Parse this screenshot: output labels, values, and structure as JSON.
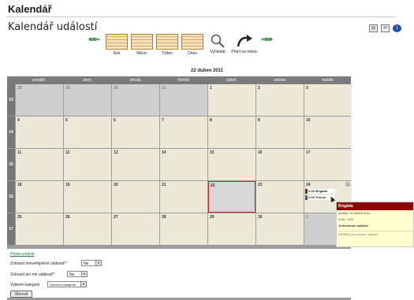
{
  "page": {
    "title": "Kalendář",
    "calendar_title": "Kalendář událostí"
  },
  "toolbar": {
    "nav_prev": "⇚⇐",
    "nav_next": "⇒⇛",
    "views": [
      {
        "label": "Rok",
        "icon": "year-grid-icon"
      },
      {
        "label": "Měsíc",
        "icon": "month-grid-icon"
      },
      {
        "label": "Týden",
        "icon": "week-grid-icon"
      },
      {
        "label": "Dnes",
        "icon": "today-icon"
      },
      {
        "label": "Vyhledat",
        "icon": "magnifier-icon"
      },
      {
        "label": "Přejít na měsíc",
        "icon": "jump-arrow-icon"
      }
    ]
  },
  "date_heading": "22 duben 2011",
  "weekdays": [
    "pondělí",
    "úterý",
    "středa",
    "čtvrtek",
    "pátek",
    "sobota",
    "neděle"
  ],
  "weeks": [
    {
      "num": "13",
      "days": [
        "28",
        "29",
        "30",
        "31",
        "1",
        "2",
        "3"
      ],
      "other": [
        true,
        true,
        true,
        true,
        false,
        false,
        false
      ]
    },
    {
      "num": "14",
      "days": [
        "4",
        "5",
        "6",
        "7",
        "8",
        "9",
        "10"
      ],
      "other": [
        false,
        false,
        false,
        false,
        false,
        false,
        false
      ]
    },
    {
      "num": "15",
      "days": [
        "11",
        "12",
        "13",
        "14",
        "15",
        "16",
        "17"
      ],
      "other": [
        false,
        false,
        false,
        false,
        false,
        false,
        false
      ]
    },
    {
      "num": "16",
      "days": [
        "18",
        "19",
        "20",
        "21",
        "22",
        "23",
        "24"
      ],
      "other": [
        false,
        false,
        false,
        false,
        false,
        false,
        false
      ]
    },
    {
      "num": "17",
      "days": [
        "25",
        "26",
        "27",
        "28",
        "29",
        "30",
        "1"
      ],
      "other": [
        false,
        false,
        false,
        false,
        false,
        false,
        true
      ]
    }
  ],
  "events": [
    {
      "text": "2:00 Brigáda"
    },
    {
      "text": "2:00 Trémin"
    }
  ],
  "tooltip": {
    "title": "Brigáda",
    "date": "neděle, 24 duben 2011",
    "time": "2:00 - 3:00",
    "type": "Jednodenní událost",
    "hint": "Klikněte pro zavření událostí"
  },
  "footer": {
    "add_event": "Přidat událost",
    "show_unpublished": "Zobrazit nezveřejněné události?",
    "show_unpublished_value": "Ne",
    "show_mine": "Zobrazit jen mé události?",
    "show_mine_value": "Ne",
    "category_label": "Vyberte kategorii",
    "category_value": "Všechny kategorie",
    "refresh": "Obnovit"
  },
  "colors": {
    "event_bar": "#8b1a1a",
    "event_bar2": "#5050b0",
    "today_border": "#d42020",
    "day_bg": "#ece9d8"
  }
}
